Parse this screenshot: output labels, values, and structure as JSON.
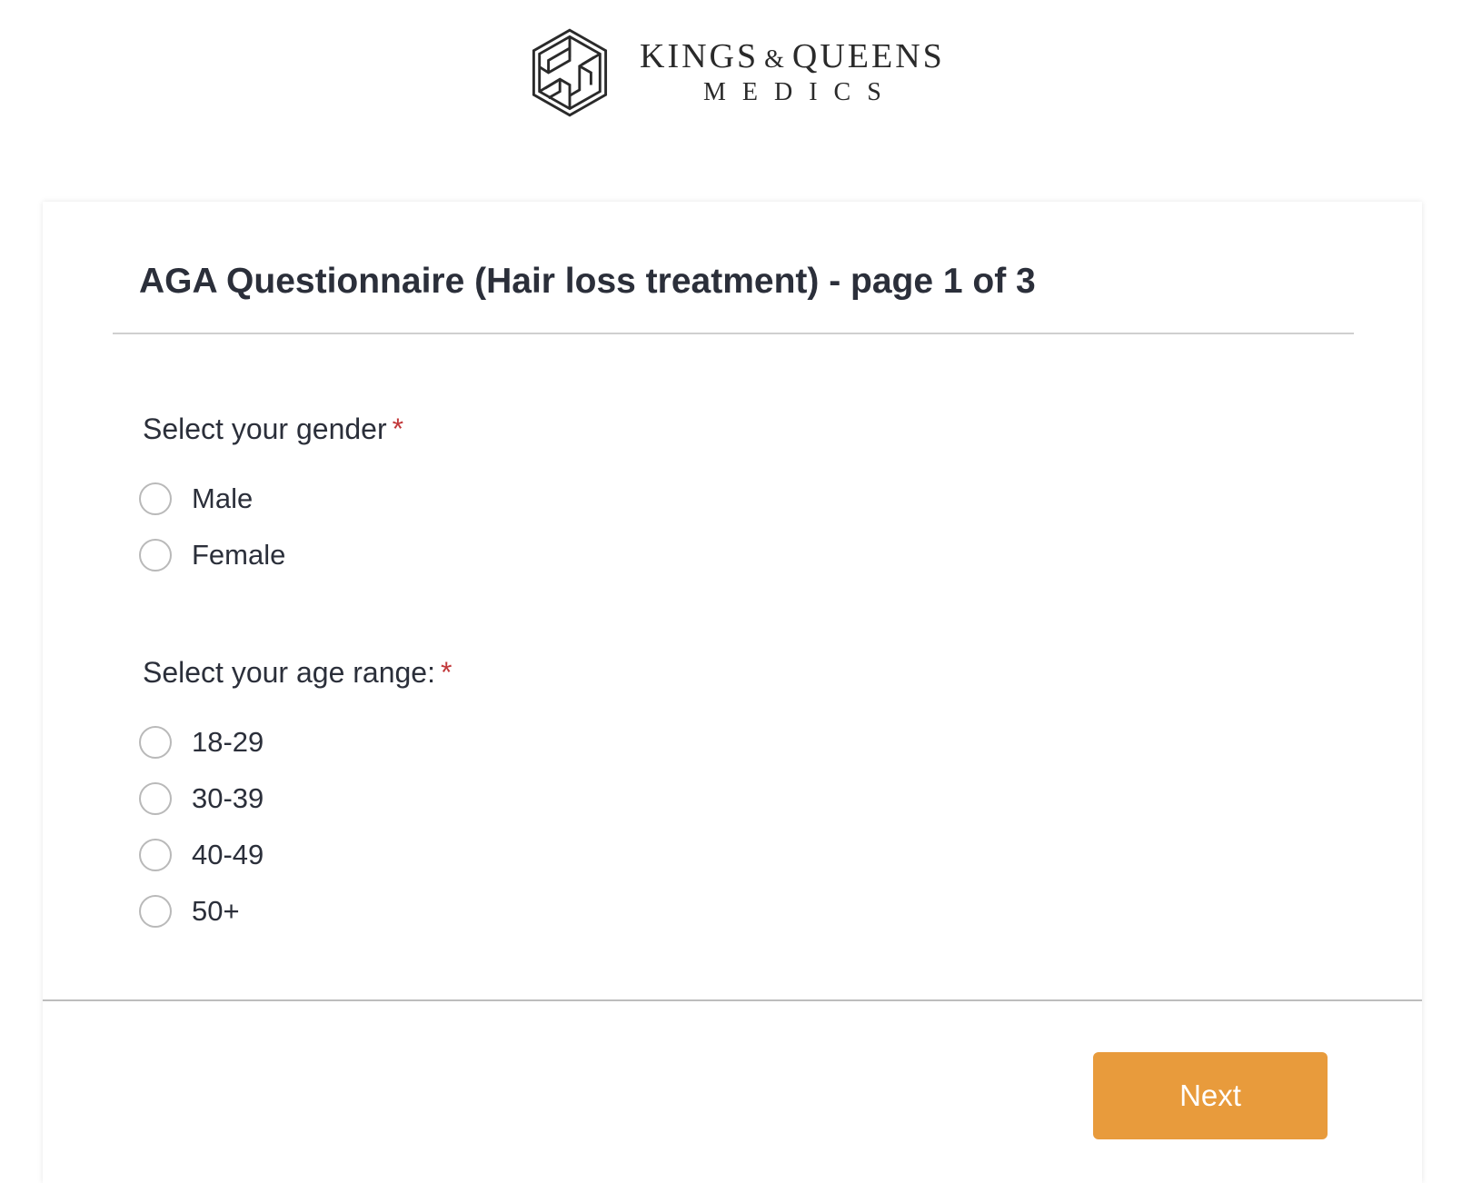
{
  "brand": {
    "name_line1_a": "KINGS",
    "name_amp": "&",
    "name_line1_b": "QUEENS",
    "name_line2": "MEDICS",
    "logo_color": "#2a2a2a"
  },
  "form": {
    "title": "AGA Questionnaire (Hair loss treatment) - page 1 of 3",
    "required_marker": "*",
    "questions": [
      {
        "label": "Select your gender",
        "required": true,
        "options": [
          "Male",
          "Female"
        ],
        "selected": null
      },
      {
        "label": "Select your age range:",
        "required": true,
        "options": [
          "18-29",
          "30-39",
          "40-49",
          "50+"
        ],
        "selected": null
      }
    ],
    "next_label": "Next"
  },
  "colors": {
    "accent": "#e89b3c",
    "required": "#c2383a",
    "text": "#2b2f3a"
  }
}
